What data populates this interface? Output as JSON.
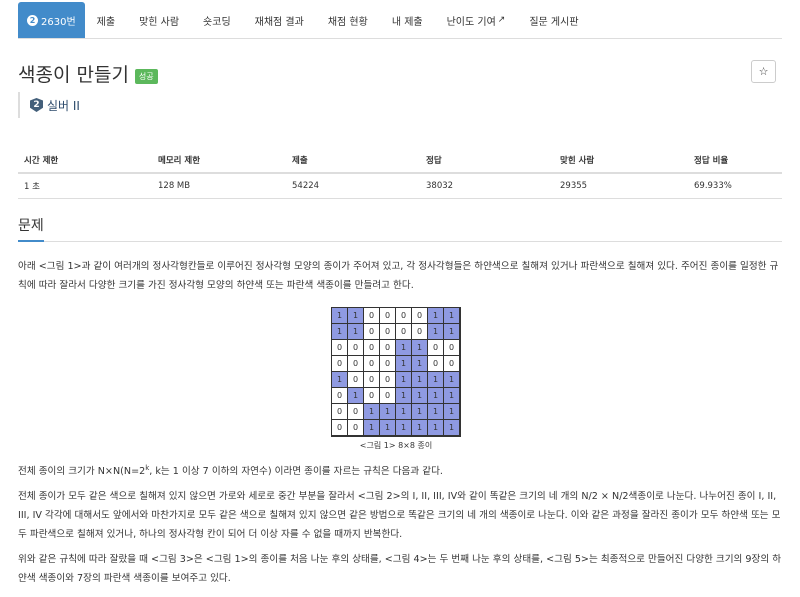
{
  "nav": {
    "tabs": [
      {
        "label": "2630번",
        "active": true
      },
      {
        "label": "제출"
      },
      {
        "label": "맞힌 사람"
      },
      {
        "label": "숏코딩"
      },
      {
        "label": "재채점 결과"
      },
      {
        "label": "채점 현황"
      },
      {
        "label": "내 제출"
      },
      {
        "label": "난이도 기여"
      },
      {
        "label": "질문 게시판"
      }
    ]
  },
  "problem": {
    "title": "색종이 만들기",
    "status_badge": "성공",
    "star": "☆",
    "tier_num": "2",
    "tier_label": "실버 II"
  },
  "info_table": {
    "headers": [
      "시간 제한",
      "메모리 제한",
      "제출",
      "정답",
      "맞힌 사람",
      "정답 비율"
    ],
    "values": [
      "1 초",
      "128 MB",
      "54224",
      "38032",
      "29355",
      "69.933%"
    ]
  },
  "section_title": "문제",
  "paragraphs": {
    "p1": "아래 <그림 1>과 같이 여러개의 정사각형칸들로 이루어진 정사각형 모양의 종이가 주어져 있고, 각 정사각형들은 하얀색으로 칠해져 있거나 파란색으로 칠해져 있다. 주어진 종이를 일정한 규칙에 따라 잘라서 다양한 크기를 가진 정사각형 모양의 하얀색 또는 파란색 색종이를 만들려고 한다.",
    "p2_pre": "전체 종이의 크기가 N×N(N=2",
    "p2_sup": "k",
    "p2_post": ", k는 1 이상 7 이하의 자연수) 이라면 종이를 자르는 규칙은 다음과 같다.",
    "p3": "전체 종이가 모두 같은 색으로 칠해져 있지 않으면 가로와 세로로 중간 부분을 잘라서 <그림 2>의 I, II, III, IV와 같이 똑같은 크기의 네 개의 N/2 × N/2색종이로 나눈다. 나누어진 종이 I, II, III, IV 각각에 대해서도 앞에서와 마찬가지로 모두 같은 색으로 칠해져 있지 않으면 같은 방법으로 똑같은 크기의 네 개의 색종이로 나눈다. 이와 같은 과정을 잘라진 종이가 모두 하얀색 또는 모두 파란색으로 칠해져 있거나, 하나의 정사각형 칸이 되어 더 이상 자를 수 없을 때까지 반복한다.",
    "p4": "위와 같은 규칙에 따라 잘랐을 때 <그림 3>은 <그림 1>의 종이를 처음 나눈 후의 상태를, <그림 4>는 두 번째 나눈 후의 상태를, <그림 5>는 최종적으로 만들어진 다양한 크기의 9장의 하얀색 색종이와 7장의 파란색 색종이를 보여주고 있다."
  },
  "figure": {
    "caption": "<그림 1> 8×8 종이",
    "grid": [
      [
        1,
        1,
        0,
        0,
        0,
        0,
        1,
        1
      ],
      [
        1,
        1,
        0,
        0,
        0,
        0,
        1,
        1
      ],
      [
        0,
        0,
        0,
        0,
        1,
        1,
        0,
        0
      ],
      [
        0,
        0,
        0,
        0,
        1,
        1,
        0,
        0
      ],
      [
        1,
        0,
        0,
        0,
        1,
        1,
        1,
        1
      ],
      [
        0,
        1,
        0,
        0,
        1,
        1,
        1,
        1
      ],
      [
        0,
        0,
        1,
        1,
        1,
        1,
        1,
        1
      ],
      [
        0,
        0,
        1,
        1,
        1,
        1,
        1,
        1
      ]
    ],
    "blue_color": "#8f9ae2"
  }
}
